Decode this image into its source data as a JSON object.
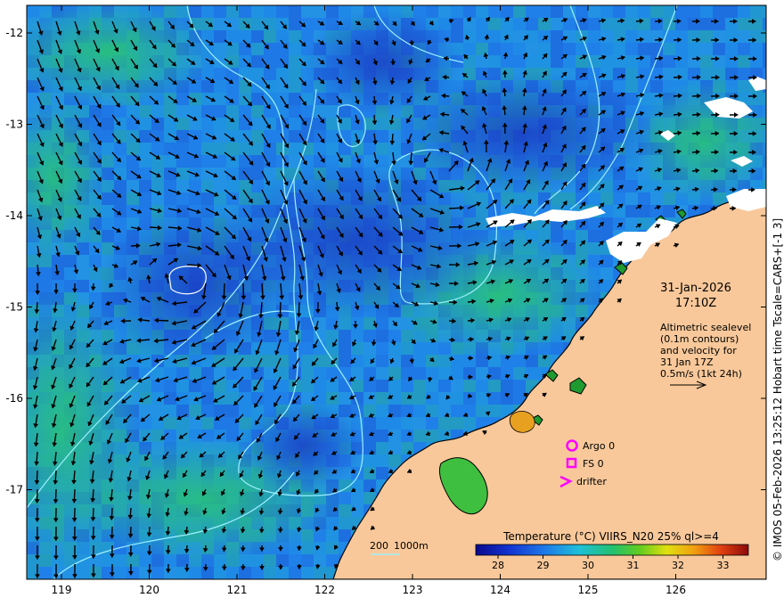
{
  "map": {
    "lon_ticks": [
      "119",
      "120",
      "121",
      "122",
      "123",
      "124",
      "125",
      "126"
    ],
    "lat_ticks": [
      "-12",
      "-13",
      "-14",
      "-15",
      "-16",
      "-17"
    ],
    "colors": {
      "ocean_deep": "#1e4fd8",
      "ocean_mid": "#1f86e8",
      "ocean_warm": "#22c08a",
      "ocean_green": "#2fae3a",
      "land": "#f8c89a",
      "coast": "#000000",
      "contour": "#9ff0ff",
      "vector": "#000000",
      "legend_marker": "#ff00ff"
    }
  },
  "date_block": {
    "date": "31-Jan-2026",
    "time": "17:10Z"
  },
  "altimetry_note": {
    "lines": [
      "Altimetric sealevel",
      "(0.1m contours)",
      "and velocity for",
      "31 Jan 17Z",
      "0.5m/s (1kt 24h)"
    ]
  },
  "legend": {
    "argo": "Argo 0",
    "fs": "FS 0",
    "drifter": "drifter"
  },
  "depth_key": {
    "a": "200",
    "b": "1000m"
  },
  "colorbar": {
    "title": "Temperature (°C) VIIRS_N20 25% ql>=4",
    "ticks": [
      "28",
      "29",
      "30",
      "31",
      "32",
      "33"
    ]
  },
  "side_caption": "© IMOS 05-Feb-2026 13:25:12 Hobart time Tscale=CARS+[-1 3]"
}
